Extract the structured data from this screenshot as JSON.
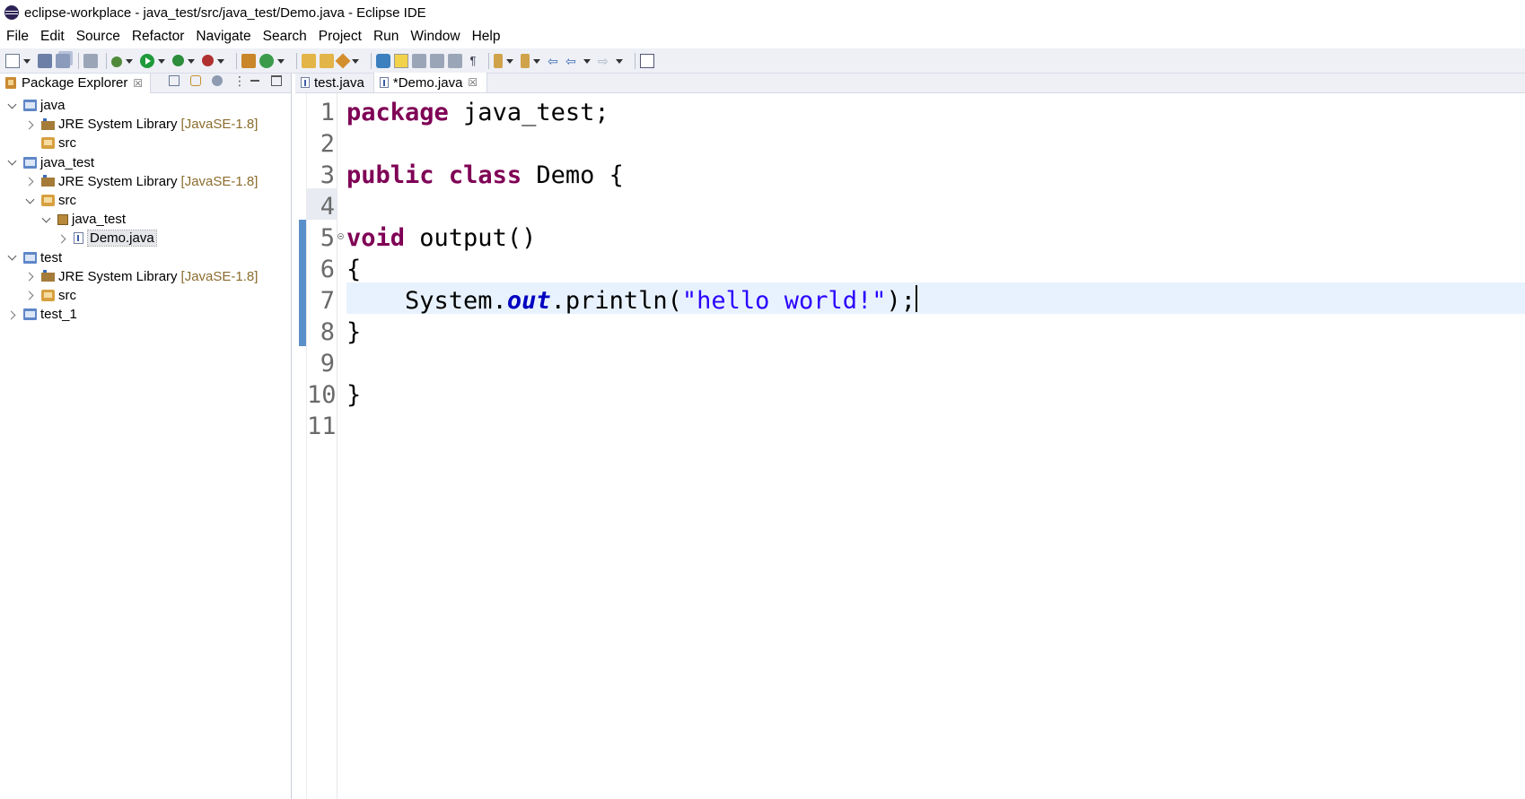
{
  "window": {
    "title": "eclipse-workplace - java_test/src/java_test/Demo.java - Eclipse IDE"
  },
  "menu": [
    "File",
    "Edit",
    "Source",
    "Refactor",
    "Navigate",
    "Search",
    "Project",
    "Run",
    "Window",
    "Help"
  ],
  "toolbar": {
    "icons": [
      "new-icon",
      "save-icon",
      "save-all-icon",
      "skip-breakpoints-icon",
      "debug-icon",
      "run-icon",
      "coverage-icon",
      "external-tools-icon",
      "new-java-package-icon",
      "new-java-class-icon",
      "open-type-icon",
      "search-icon",
      "toggle-mark-occurrences-icon",
      "toggle-highlight-icon",
      "block-selection-icon",
      "show-whitespace-icon",
      "next-annotation-icon",
      "previous-annotation-icon",
      "last-edit-location-icon",
      "back-icon",
      "forward-icon",
      "open-perspective-icon"
    ]
  },
  "package_explorer": {
    "title": "Package Explorer",
    "close": "☒",
    "tree": [
      {
        "label": "java",
        "hint": "",
        "icon": "project-icon",
        "twisty": "open",
        "indent": 0,
        "selected": false
      },
      {
        "label": "JRE System Library",
        "hint": "[JavaSE-1.8]",
        "icon": "library-icon",
        "twisty": "closed",
        "indent": 1,
        "selected": false
      },
      {
        "label": "src",
        "hint": "",
        "icon": "source-folder-icon",
        "twisty": "none",
        "indent": 1,
        "selected": false
      },
      {
        "label": "java_test",
        "hint": "",
        "icon": "project-icon",
        "twisty": "open",
        "indent": 0,
        "selected": false
      },
      {
        "label": "JRE System Library",
        "hint": "[JavaSE-1.8]",
        "icon": "library-icon",
        "twisty": "closed",
        "indent": 1,
        "selected": false
      },
      {
        "label": "src",
        "hint": "",
        "icon": "source-folder-icon",
        "twisty": "open",
        "indent": 1,
        "selected": false
      },
      {
        "label": "java_test",
        "hint": "",
        "icon": "package-icon",
        "twisty": "open",
        "indent": 2,
        "selected": false
      },
      {
        "label": "Demo.java",
        "hint": "",
        "icon": "java-file-icon",
        "twisty": "closed",
        "indent": 3,
        "selected": true
      },
      {
        "label": "test",
        "hint": "",
        "icon": "project-icon",
        "twisty": "open",
        "indent": 0,
        "selected": false
      },
      {
        "label": "JRE System Library",
        "hint": "[JavaSE-1.8]",
        "icon": "library-icon",
        "twisty": "closed",
        "indent": 1,
        "selected": false
      },
      {
        "label": "src",
        "hint": "",
        "icon": "source-folder-icon",
        "twisty": "closed",
        "indent": 1,
        "selected": false
      },
      {
        "label": "test_1",
        "hint": "",
        "icon": "project-icon",
        "twisty": "closed",
        "indent": 0,
        "selected": false
      }
    ]
  },
  "editor": {
    "tabs": [
      {
        "label": "test.java",
        "active": false,
        "close": ""
      },
      {
        "label": "*Demo.java",
        "active": true,
        "close": "☒"
      }
    ],
    "line_numbers": [
      "1",
      "2",
      "3",
      "4",
      "5",
      "6",
      "7",
      "8",
      "9",
      "10",
      "11"
    ],
    "lines": [
      [
        {
          "t": "package",
          "c": "kw"
        },
        {
          "t": " java_test;",
          "c": ""
        }
      ],
      [],
      [
        {
          "t": "public",
          "c": "kw"
        },
        {
          "t": " ",
          "c": ""
        },
        {
          "t": "class",
          "c": "kw"
        },
        {
          "t": " Demo {",
          "c": ""
        }
      ],
      [],
      [
        {
          "t": "void",
          "c": "kw"
        },
        {
          "t": " output()",
          "c": ""
        }
      ],
      [
        {
          "t": "{",
          "c": ""
        }
      ],
      [
        {
          "t": "    System.",
          "c": ""
        },
        {
          "t": "out",
          "c": "field"
        },
        {
          "t": ".println(",
          "c": ""
        },
        {
          "t": "\"hello world!\"",
          "c": "str"
        },
        {
          "t": ");",
          "c": ""
        }
      ],
      [
        {
          "t": "}",
          "c": ""
        }
      ],
      [],
      [
        {
          "t": "}",
          "c": ""
        }
      ],
      []
    ],
    "current_line": 7
  }
}
